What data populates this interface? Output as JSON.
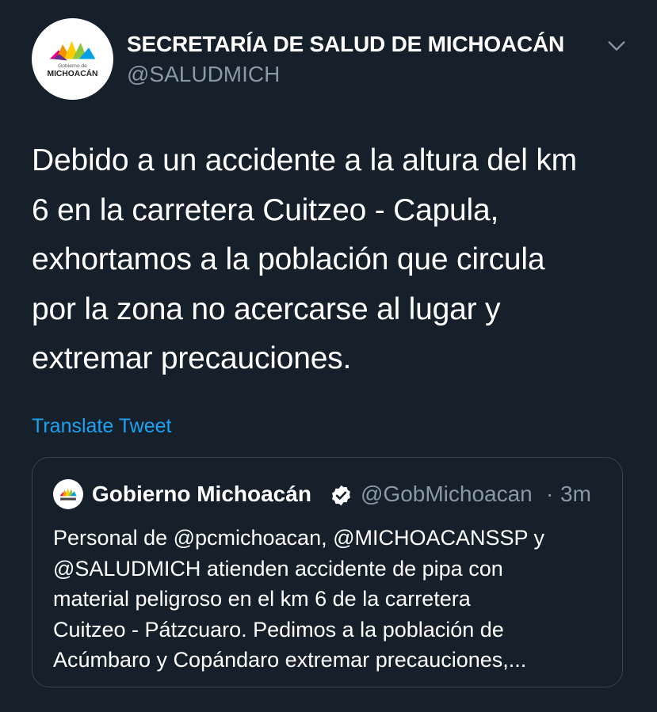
{
  "author": {
    "display_name": "SECRETARÍA DE SALUD DE MICHOACÁN",
    "handle": "@SALUDMICH",
    "avatar_text_top": "Gobierno de",
    "avatar_text_bottom": "MICHOACÁN"
  },
  "tweet": {
    "lines": [
      "Debido a un accidente a la altura del km",
      "6 en la carretera Cuitzeo - Capula,",
      "exhortamos a la población que circula",
      "por la zona no acercarse al lugar y",
      "extremar precauciones."
    ],
    "translate_label": "Translate Tweet"
  },
  "quote": {
    "display_name": "Gobierno Michoacán",
    "handle": "@GobMichoacan",
    "separator": "·",
    "time": "3m",
    "lines": [
      "Personal de @pcmichoacan, @MICHOACANSSP y",
      "@SALUDMICH atienden accidente de pipa con",
      "material peligroso en el km 6 de la carretera",
      "Cuitzeo - Pátzcuaro. Pedimos a la población de",
      "Acúmbaro y Copándaro extremar precauciones,..."
    ]
  },
  "icons": {
    "menu": "chevron-down-icon",
    "verified": "verified-badge-icon"
  },
  "colors": {
    "background": "#15202b",
    "link": "#1da1f2",
    "secondary_text": "#8899a6",
    "border": "#38444d"
  }
}
